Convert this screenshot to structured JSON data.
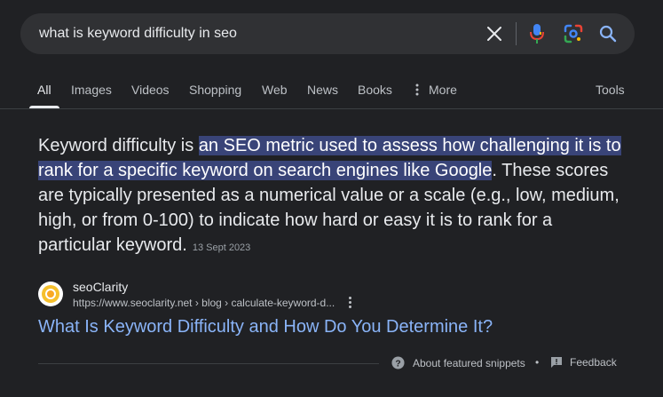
{
  "search": {
    "query": "what is keyword difficulty in seo"
  },
  "tabs": [
    {
      "label": "All"
    },
    {
      "label": "Images"
    },
    {
      "label": "Videos"
    },
    {
      "label": "Shopping"
    },
    {
      "label": "Web"
    },
    {
      "label": "News"
    },
    {
      "label": "Books"
    },
    {
      "label": "More"
    }
  ],
  "tools_label": "Tools",
  "snippet": {
    "lead": "Keyword difficulty is ",
    "highlight": "an SEO metric used to assess how challenging it is to rank for a specific keyword on search engines like Google",
    "rest": ". These scores are typically presented as a numerical value or a scale (e.g., low, medium, high, or from 0-100) to indicate how hard or easy it is to rank for a particular keyword.",
    "date": "13 Sept 2023",
    "highlight_color": "#394478"
  },
  "source": {
    "site_name": "seoClarity",
    "url": "https://www.seoclarity.net › blog › calculate-keyword-d..."
  },
  "result": {
    "title": "What Is Keyword Difficulty and How Do You Determine It?",
    "link_color": "#8ab4f8"
  },
  "footer": {
    "about_label": "About featured snippets",
    "separator": "•",
    "feedback_label": "Feedback"
  }
}
